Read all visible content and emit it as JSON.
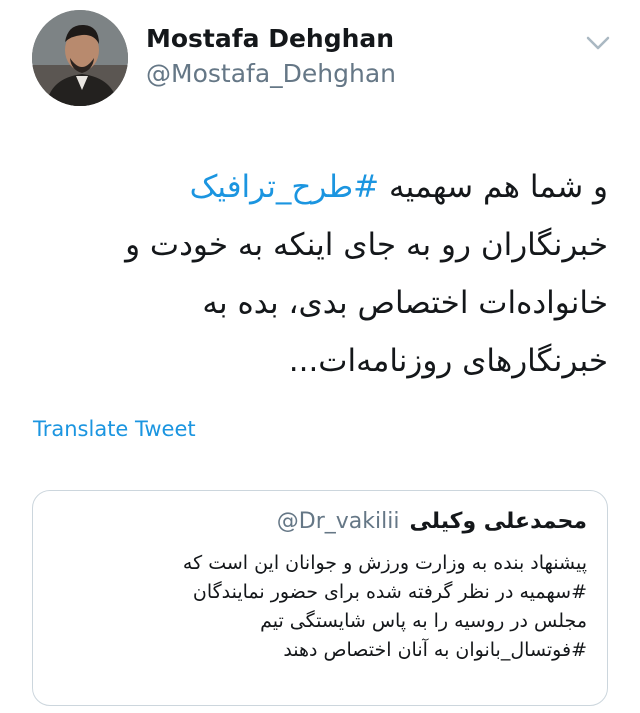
{
  "author": {
    "name": "Mostafa Dehghan",
    "handle": "@Mostafa_Dehghan"
  },
  "icons": {
    "avatar": "user-avatar-photo",
    "menu": "chevron-down-icon"
  },
  "colors": {
    "link": "#1b95e0",
    "text": "#14171a",
    "secondary": "#657786",
    "border": "#ccd6dd"
  },
  "tweet": {
    "line1_prefix": "و شما هم سهمیه ",
    "line1_hashtag": "#طرح_ترافیک",
    "line2": "خبرنگاران رو به جای اینکه به خودت و",
    "line3": "خانواده‌ات اختصاص بدی، بده به",
    "line4": "خبرنگارهای روزنامه‌ات..."
  },
  "translate_label": "Translate Tweet",
  "quoted_tweet": {
    "name": "محمدعلی وکیلی",
    "handle": "@Dr_vakilii",
    "lines": [
      "پیشنهاد بنده به وزارت ورزش و جوانان این است که",
      "#سهمیه در نظر گرفته شده برای حضور نمایندگان",
      "مجلس در روسیه را به پاس شایستگی تیم",
      "#فوتسال_بانوان به آنان اختصاص دهند"
    ]
  }
}
